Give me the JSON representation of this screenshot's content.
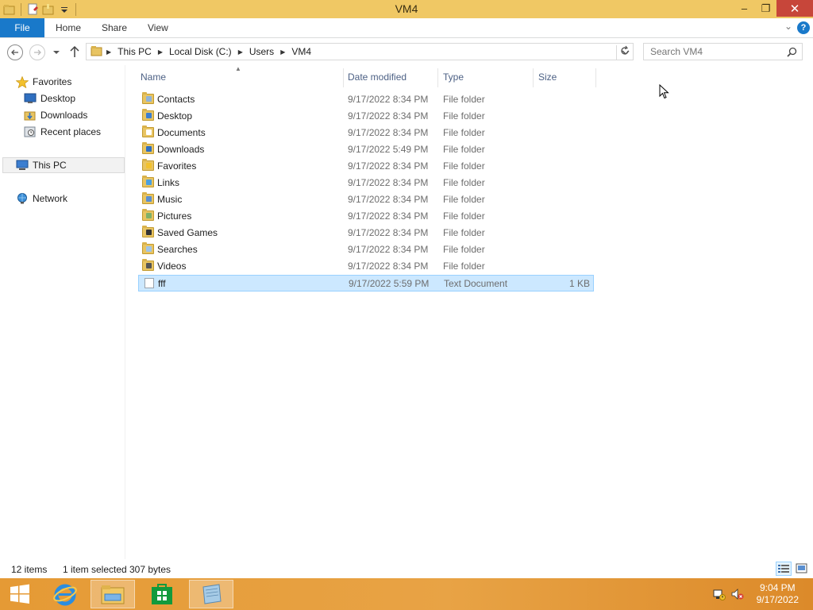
{
  "window": {
    "title": "VM4"
  },
  "title_buttons": {
    "minimize": "–",
    "restore": "❐",
    "close": "✕"
  },
  "ribbon": {
    "tabs": [
      "File",
      "Home",
      "Share",
      "View"
    ],
    "help": "?",
    "expand": "⌄"
  },
  "address": {
    "breadcrumbs": [
      "This PC",
      "Local Disk (C:)",
      "Users",
      "VM4"
    ],
    "search_placeholder": "Search VM4"
  },
  "nav": {
    "favorites_label": "Favorites",
    "favorites": [
      "Desktop",
      "Downloads",
      "Recent places"
    ],
    "this_pc": "This PC",
    "network": "Network"
  },
  "columns": {
    "name": "Name",
    "date": "Date modified",
    "type": "Type",
    "size": "Size"
  },
  "files": [
    {
      "name": "Contacts",
      "date": "9/17/2022 8:34 PM",
      "type": "File folder",
      "size": "",
      "icon": "contacts-folder"
    },
    {
      "name": "Desktop",
      "date": "9/17/2022 8:34 PM",
      "type": "File folder",
      "size": "",
      "icon": "desktop-folder"
    },
    {
      "name": "Documents",
      "date": "9/17/2022 8:34 PM",
      "type": "File folder",
      "size": "",
      "icon": "documents-folder"
    },
    {
      "name": "Downloads",
      "date": "9/17/2022 5:49 PM",
      "type": "File folder",
      "size": "",
      "icon": "downloads-folder"
    },
    {
      "name": "Favorites",
      "date": "9/17/2022 8:34 PM",
      "type": "File folder",
      "size": "",
      "icon": "favorites-folder"
    },
    {
      "name": "Links",
      "date": "9/17/2022 8:34 PM",
      "type": "File folder",
      "size": "",
      "icon": "links-folder"
    },
    {
      "name": "Music",
      "date": "9/17/2022 8:34 PM",
      "type": "File folder",
      "size": "",
      "icon": "music-folder"
    },
    {
      "name": "Pictures",
      "date": "9/17/2022 8:34 PM",
      "type": "File folder",
      "size": "",
      "icon": "pictures-folder"
    },
    {
      "name": "Saved Games",
      "date": "9/17/2022 8:34 PM",
      "type": "File folder",
      "size": "",
      "icon": "saved-games-folder"
    },
    {
      "name": "Searches",
      "date": "9/17/2022 8:34 PM",
      "type": "File folder",
      "size": "",
      "icon": "searches-folder"
    },
    {
      "name": "Videos",
      "date": "9/17/2022 8:34 PM",
      "type": "File folder",
      "size": "",
      "icon": "videos-folder"
    },
    {
      "name": "fff",
      "date": "9/17/2022 5:59 PM",
      "type": "Text Document",
      "size": "1 KB",
      "icon": "text-document",
      "selected": true
    }
  ],
  "status": {
    "items": "12 items",
    "selected": "1 item selected",
    "bytes": "307 bytes"
  },
  "taskbar": {
    "time": "9:04 PM",
    "date": "9/17/2022"
  },
  "colors": {
    "title_bar": "#f0c864",
    "file_tab": "#1979ca",
    "selection": "#cce8ff",
    "selection_border": "#99d1ff",
    "taskbar": "#e59a35"
  }
}
